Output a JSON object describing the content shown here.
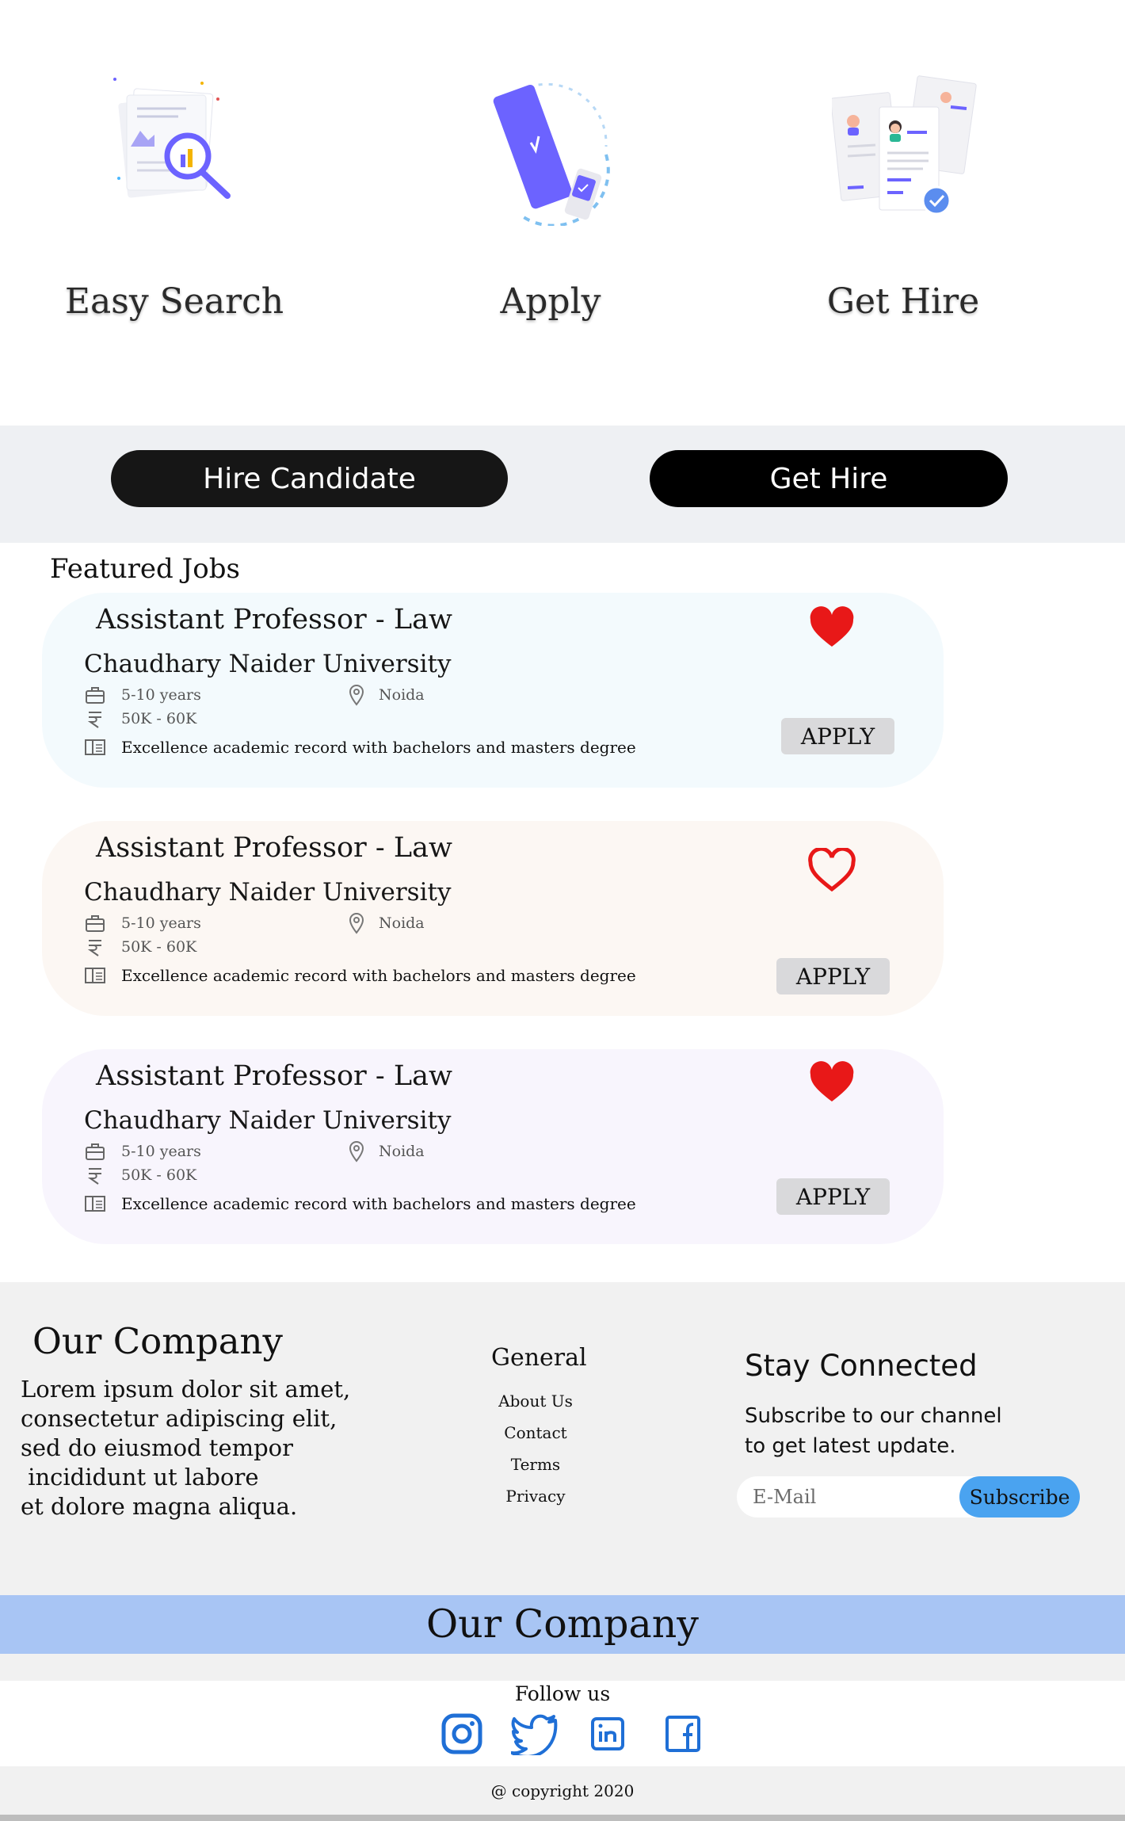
{
  "steps": [
    {
      "label": "Easy Search",
      "icon": "search-documents-illustration"
    },
    {
      "label": "Apply",
      "icon": "phone-apply-illustration"
    },
    {
      "label": "Get Hire",
      "icon": "resumes-approved-illustration"
    }
  ],
  "cta": {
    "hire_candidate": "Hire Candidate",
    "get_hire": "Get Hire"
  },
  "featured": {
    "title": "Featured Jobs",
    "jobs": [
      {
        "title": "Assistant Professor - Law",
        "company": "Chaudhary Naider University",
        "experience": "5-10 years",
        "location": "Noida",
        "salary": "50K - 60K",
        "description": "Excellence academic record with bachelors and masters degree",
        "apply": "APPLY",
        "favorited": true,
        "background": "#f3fafd"
      },
      {
        "title": "Assistant Professor - Law",
        "company": "Chaudhary Naider University",
        "experience": "5-10 years",
        "location": "Noida",
        "salary": "50K - 60K",
        "description": "Excellence academic record with bachelors and masters degree",
        "apply": "APPLY",
        "favorited": false,
        "background": "#fcf7f3"
      },
      {
        "title": "Assistant Professor - Law",
        "company": "Chaudhary Naider University",
        "experience": "5-10 years",
        "location": "Noida",
        "salary": "50K - 60K",
        "description": "Excellence academic record with bachelors and masters degree",
        "apply": "APPLY",
        "favorited": true,
        "background": "#f8f5fd"
      }
    ]
  },
  "footer": {
    "company_title": "Our Company",
    "lorem": "Lorem ipsum dolor sit amet,\nconsectetur adipiscing elit,\nsed do eiusmod tempor\n incididunt ut labore\net dolore magna aliqua.",
    "general_title": "General",
    "links": [
      "About Us",
      "Contact",
      "Terms",
      "Privacy"
    ],
    "stay_title": "Stay Connected",
    "stay_text": "Subscribe to our channel to get latest update.",
    "email_placeholder": "E-Mail",
    "subscribe": "Subscribe",
    "brand": "Our Company",
    "follow_label": "Follow us",
    "social": [
      "instagram-icon",
      "twitter-icon",
      "linkedin-icon",
      "facebook-icon"
    ],
    "copyright": "@ copyright 2020"
  },
  "colors": {
    "heart": "#e81818",
    "social": "#1f6fd6",
    "accent_illustration": "#6c63ff",
    "brand_band": "#a8c5f4",
    "subscribe": "#4aa3f0"
  }
}
